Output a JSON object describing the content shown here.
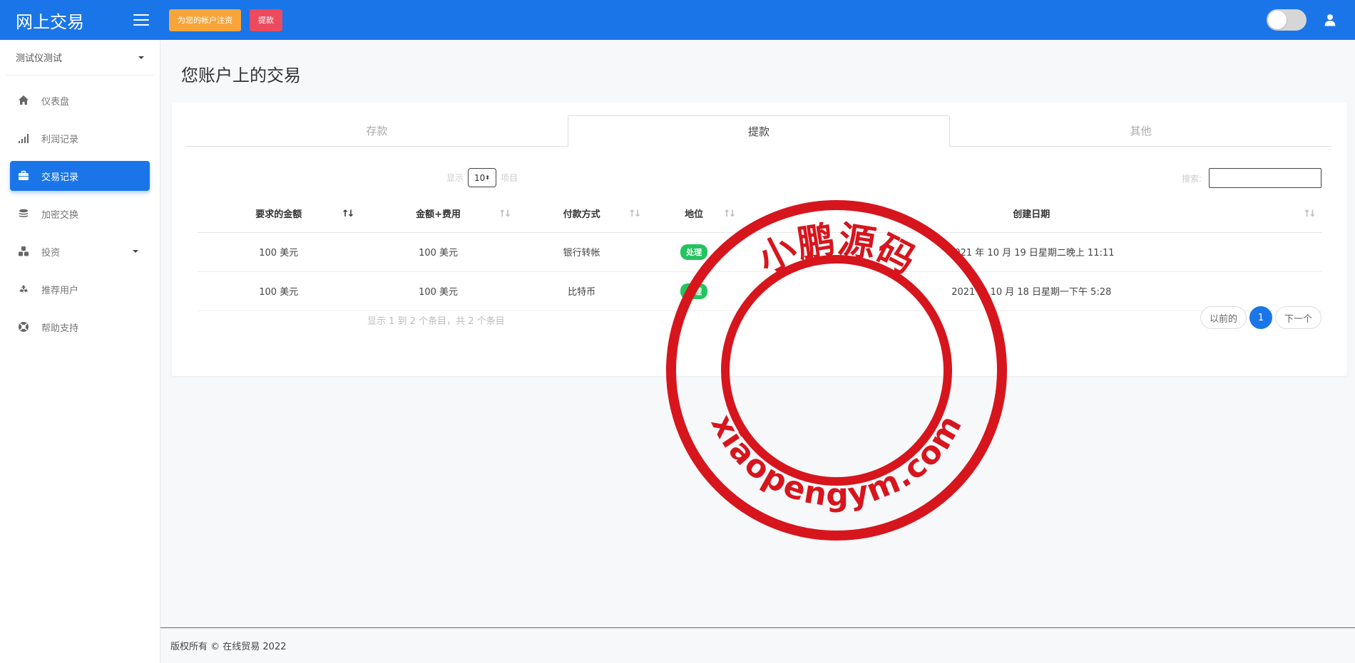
{
  "header": {
    "brand": "网上交易",
    "register_button": "为您的帐户注资",
    "withdraw_button": "提款"
  },
  "sidebar": {
    "account_name": "测试仪测试",
    "items": [
      {
        "label": "仪表盘",
        "icon": "home-icon"
      },
      {
        "label": "利润记录",
        "icon": "signal-bars-icon"
      },
      {
        "label": "交易记录",
        "icon": "briefcase-icon",
        "active": true
      },
      {
        "label": "加密交换",
        "icon": "coins-icon"
      },
      {
        "label": "投资",
        "icon": "cubes-icon",
        "has_submenu": true
      },
      {
        "label": "推荐用户",
        "icon": "recycle-icon"
      },
      {
        "label": "帮助支持",
        "icon": "support-icon"
      }
    ]
  },
  "main": {
    "title": "您账户上的交易",
    "tabs": [
      {
        "label": "存款",
        "active": false
      },
      {
        "label": "提款",
        "active": true
      },
      {
        "label": "其他",
        "active": false
      }
    ],
    "length_prefix": "显示",
    "length_value": "10",
    "length_suffix": "项目",
    "search_label": "搜索:",
    "search_value": "",
    "table": {
      "columns": [
        "要求的金额",
        "金额+费用",
        "付款方式",
        "地位",
        "创建日期"
      ],
      "rows": [
        {
          "amount": "100 美元",
          "amount_fee": "100 美元",
          "method": "银行转帐",
          "status": "处理",
          "date": "2021 年 10 月 19 日星期二晚上 11:11"
        },
        {
          "amount": "100 美元",
          "amount_fee": "100 美元",
          "method": "比特币",
          "status": "处理",
          "date": "2021 年 10 月 18 日星期一下午 5:28"
        }
      ]
    },
    "info": "显示 1 到 2 个条目，共 2 个条目",
    "pagination": {
      "prev": "以前的",
      "current": "1",
      "next": "下一个"
    }
  },
  "watermark": {
    "top_text": "小鹏源码",
    "bottom_text": "xiaopengym.com",
    "color": "#d7151d"
  },
  "footer": {
    "copyright": "版权所有 © 在线贸易 2022"
  },
  "colors": {
    "primary": "#1a76e8",
    "orange": "#f7a53b",
    "red": "#ec4a5e",
    "success": "#23c45e"
  }
}
